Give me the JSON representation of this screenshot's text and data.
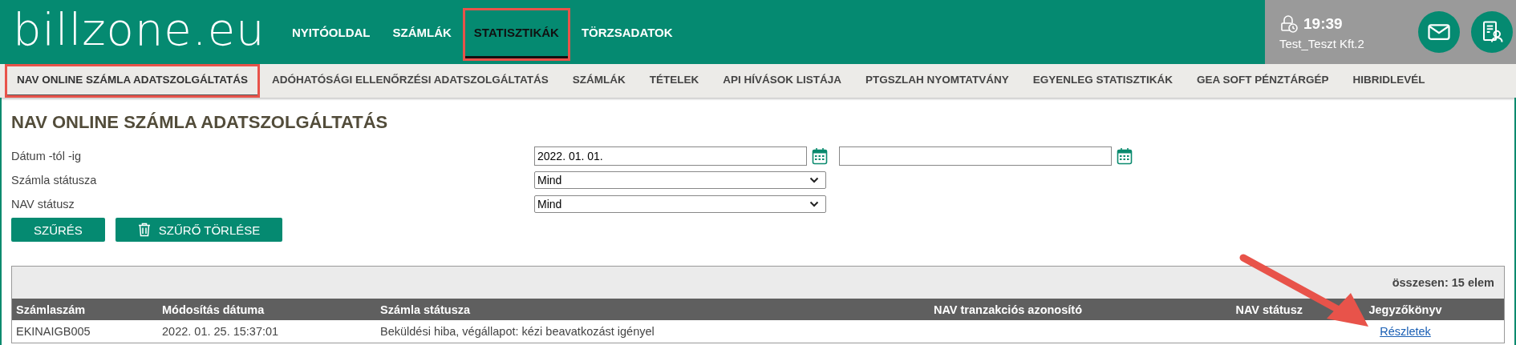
{
  "logo": "billzone.eu",
  "nav": [
    {
      "label": "NYITÓOLDAL",
      "selected": false,
      "annotated": false
    },
    {
      "label": "SZÁMLÁK",
      "selected": false,
      "annotated": false
    },
    {
      "label": "STATISZTIKÁK",
      "selected": true,
      "annotated": true
    },
    {
      "label": "TÖRZSADATOK",
      "selected": false,
      "annotated": false
    }
  ],
  "session": {
    "time": "19:39",
    "company": "Test_Teszt Kft.2"
  },
  "subnav": [
    {
      "label": "NAV ONLINE SZÁMLA ADATSZOLGÁLTATÁS",
      "selected": true,
      "annotated": true
    },
    {
      "label": "ADÓHATÓSÁGI ELLENŐRZÉSI ADATSZOLGÁLTATÁS",
      "selected": false,
      "annotated": false
    },
    {
      "label": "SZÁMLÁK",
      "selected": false,
      "annotated": false
    },
    {
      "label": "TÉTELEK",
      "selected": false,
      "annotated": false
    },
    {
      "label": "API HÍVÁSOK LISTÁJA",
      "selected": false,
      "annotated": false
    },
    {
      "label": "PTGSZLAH NYOMTATVÁNY",
      "selected": false,
      "annotated": false
    },
    {
      "label": "EGYENLEG STATISZTIKÁK",
      "selected": false,
      "annotated": false
    },
    {
      "label": "GEA SOFT PÉNZTÁRGÉP",
      "selected": false,
      "annotated": false
    },
    {
      "label": "HIBRIDLEVÉL",
      "selected": false,
      "annotated": false
    }
  ],
  "title": "NAV ONLINE SZÁMLA ADATSZOLGÁLTATÁS",
  "filters": [
    {
      "label": "Dátum -tól -ig",
      "kind": "daterange",
      "from": "2022. 01. 01."
    },
    {
      "label": "Számla státusza",
      "kind": "select",
      "value": "Mind"
    },
    {
      "label": "NAV státusz",
      "kind": "select",
      "value": "Mind"
    }
  ],
  "buttons": [
    {
      "label": "SZŰRÉS",
      "kind": "plain"
    },
    {
      "label": "SZŰRŐ TÖRLÉSE",
      "kind": "trash"
    }
  ],
  "table": {
    "total": "összesen: 15 elem",
    "columns": [
      {
        "label": "Számlaszám"
      },
      {
        "label": "Módosítás dátuma"
      },
      {
        "label": "Számla státusza"
      },
      {
        "label": "NAV tranzakciós azonosító"
      },
      {
        "label": "NAV státusz"
      },
      {
        "label": "Jegyzőkönyv"
      }
    ],
    "rows": [
      {
        "cells": [
          "EKINAIGB005",
          "2022. 01. 25. 15:37:01",
          "Beküldési hiba, végállapot: kézi beavatkozást igényel",
          "",
          ""
        ],
        "link": "Részletek"
      }
    ]
  },
  "annotation_arrow": true
}
